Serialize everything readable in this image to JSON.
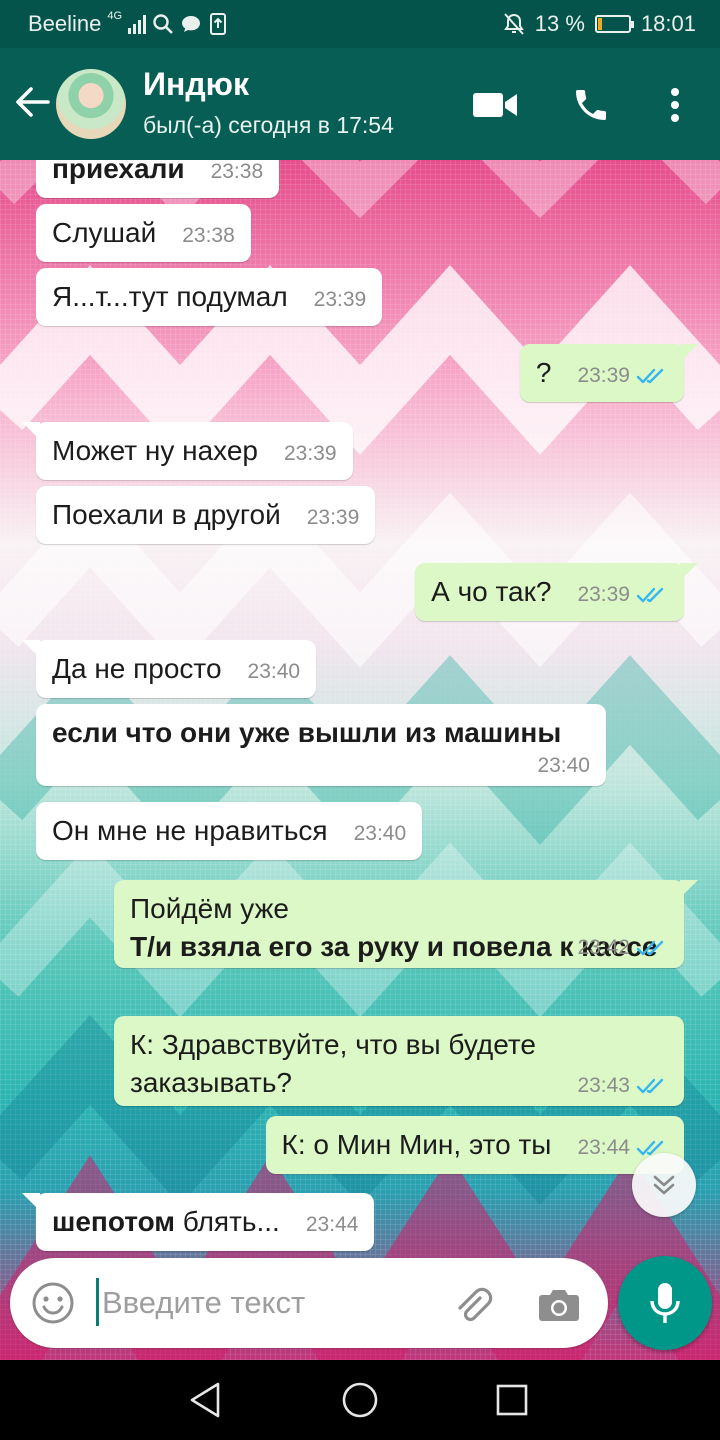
{
  "status_bar": {
    "carrier": "Beeline",
    "network": "4G",
    "battery_text": "13 %",
    "battery_level": 0.13,
    "time": "18:01"
  },
  "header": {
    "contact_name": "Индюк",
    "last_seen": "был(-а) сегодня в 17:54",
    "icons": [
      "back-arrow-icon",
      "video-call-icon",
      "phone-icon",
      "more-vert-icon"
    ]
  },
  "messages": [
    {
      "dir": "in",
      "text": "приехали",
      "time": "23:38"
    },
    {
      "dir": "in",
      "text": "Слушай",
      "time": "23:38"
    },
    {
      "dir": "in",
      "text": "Я...т...тут подумал",
      "time": "23:39"
    },
    {
      "dir": "out",
      "text": "?",
      "time": "23:39",
      "read": true
    },
    {
      "dir": "in",
      "text": "Может ну нахер",
      "time": "23:39"
    },
    {
      "dir": "in",
      "text": "Поехали в другой",
      "time": "23:39"
    },
    {
      "dir": "out",
      "text": "А чо так?",
      "time": "23:39",
      "read": true
    },
    {
      "dir": "in",
      "text": "Да не просто",
      "time": "23:40"
    },
    {
      "dir": "in",
      "text": "если что они уже вышли из машины",
      "time": "23:40"
    },
    {
      "dir": "in",
      "text": "Он мне не нравиться",
      "time": "23:40"
    },
    {
      "dir": "out",
      "line1": "Пойдём уже",
      "line2": "Т/и взяла его за руку и повела к кассе",
      "time": "23:42",
      "read": true
    },
    {
      "dir": "out",
      "text": "К: Здравствуйте, что вы будете заказывать?",
      "time": "23:43",
      "read": true
    },
    {
      "dir": "out",
      "text": "К: о Мин Мин, это ты",
      "time": "23:44",
      "read": true
    },
    {
      "dir": "in",
      "bold": "шепотом",
      "text": " блять...",
      "time": "23:44"
    }
  ],
  "input": {
    "placeholder": "Введите текст",
    "icons": [
      "emoji-icon",
      "attach-icon",
      "camera-icon",
      "mic-icon"
    ]
  },
  "colors": {
    "header": "#075e54",
    "outgoing": "#dcf8c6",
    "incoming": "#ffffff",
    "fab": "#009688",
    "read_ticks": "#34b7f1"
  }
}
